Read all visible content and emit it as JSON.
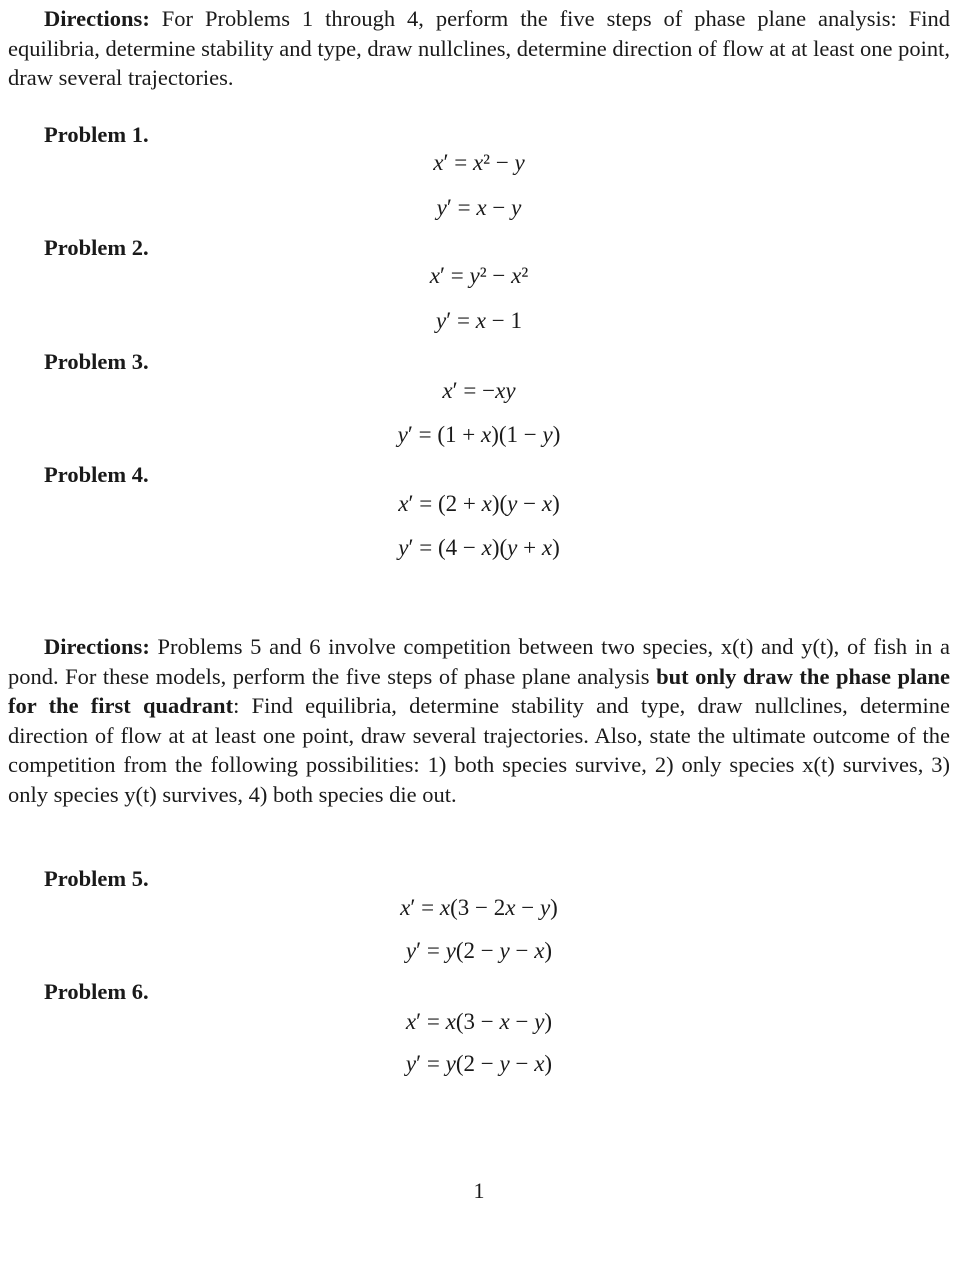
{
  "section1": {
    "heading": "Directions:",
    "text": "For Problems 1 through 4, perform the five steps of phase plane analysis: Find equilibria, determine stability and type, draw nullclines, determine direction of flow at at least one point, draw several trajectories."
  },
  "problems": [
    {
      "label": "Problem 1.",
      "eq1": "x′ = x² − y",
      "eq2": "y′ = x − y"
    },
    {
      "label": "Problem 2.",
      "eq1": "x′ = y² − x²",
      "eq2": "y′ = x − 1"
    },
    {
      "label": "Problem 3.",
      "eq1": "x′ = −xy",
      "eq2": "y′ = (1 + x)(1 − y)"
    },
    {
      "label": "Problem 4.",
      "eq1": "x′ = (2 + x)(y − x)",
      "eq2": "y′ = (4 − x)(y + x)"
    },
    {
      "label": "Problem 5.",
      "eq1": "x′ = x(3 − 2x − y)",
      "eq2": "y′ = y(2 − y − x)"
    },
    {
      "label": "Problem 6.",
      "eq1": "x′ = x(3 − x − y)",
      "eq2": "y′ = y(2 − y − x)"
    }
  ],
  "section2": {
    "heading": "Directions:",
    "text_a": "Problems 5 and 6 involve competition between two species, x(t) and y(t), of fish in a pond. For these models, perform the five steps of phase plane analysis",
    "bold": "but only draw the phase plane for the first quadrant",
    "text_b": ": Find equilibria, determine stability and type, draw nullclines, determine direction of flow at at least one point, draw several trajectories. Also, state the ultimate outcome of the competition from the following possibilities: 1) both species survive, 2) only species x(t) survives, 3) only species y(t) survives, 4) both species die out."
  },
  "page_number": "1"
}
